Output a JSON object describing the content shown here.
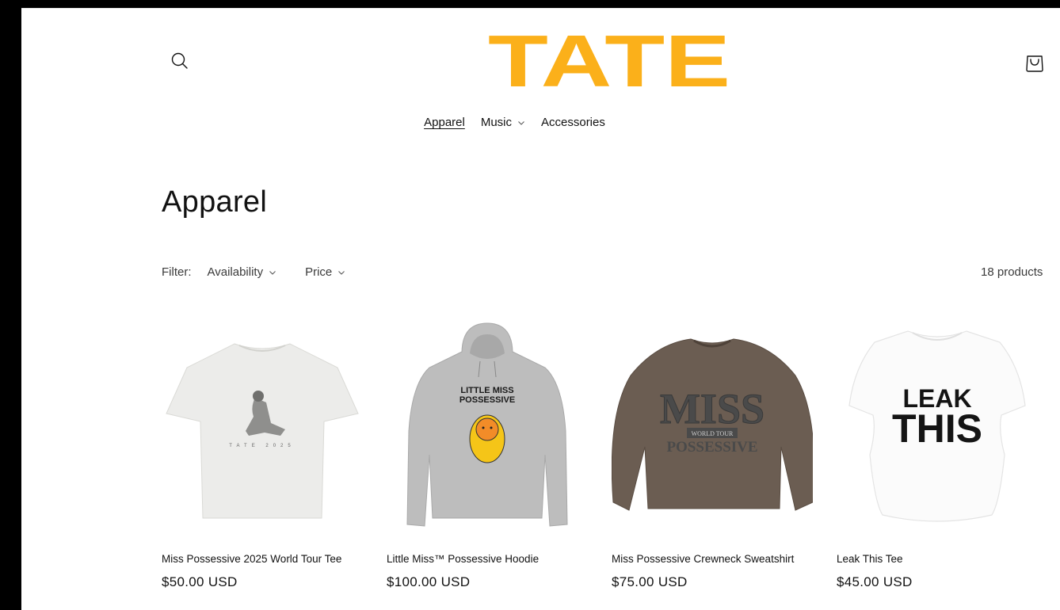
{
  "header": {
    "brand": "TATE",
    "brand_color": "#fbb01a",
    "search_icon": "search-icon",
    "cart_icon": "cart-icon"
  },
  "nav": {
    "items": [
      {
        "label": "Apparel",
        "active": true
      },
      {
        "label": "Music",
        "has_dropdown": true
      },
      {
        "label": "Accessories"
      }
    ]
  },
  "collection": {
    "title": "Apparel",
    "filter_label": "Filter:",
    "filters": [
      {
        "label": "Availability"
      },
      {
        "label": "Price"
      }
    ],
    "product_count": "18 products"
  },
  "products": [
    {
      "name": "Miss Possessive 2025 World Tour Tee",
      "price": "$50.00 USD",
      "image": "white-tee-photo"
    },
    {
      "name": "Little Miss™ Possessive Hoodie",
      "price": "$100.00 USD",
      "image": "grey-hoodie-photo",
      "print_line1": "LITTLE MISS",
      "print_line2": "POSSESSIVE"
    },
    {
      "name": "Miss Possessive Crewneck Sweatshirt",
      "price": "$75.00 USD",
      "image": "brown-crewneck-photo",
      "print_line1": "MISS",
      "print_line2": "WORLD TOUR",
      "print_line3": "POSSESSIVE"
    },
    {
      "name": "Leak This Tee",
      "price": "$45.00 USD",
      "image": "white-baby-tee-photo",
      "print_line1": "LEAK",
      "print_line2": "THIS"
    }
  ],
  "tee_print_caption": "TATE 2025"
}
